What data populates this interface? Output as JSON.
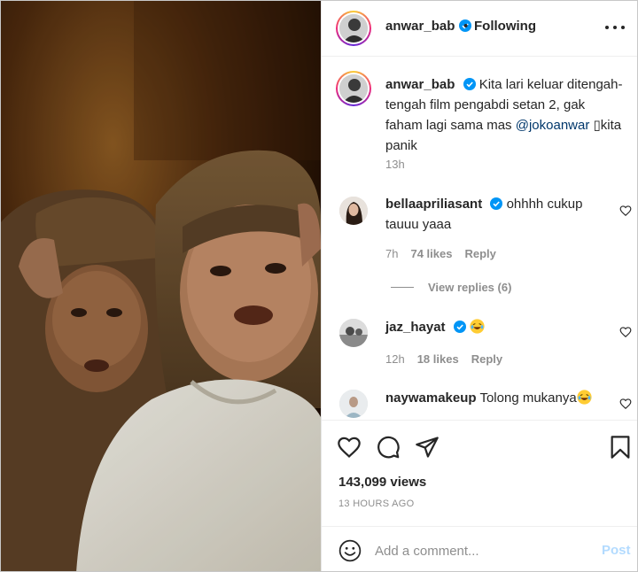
{
  "post": {
    "author": "anwar_bab",
    "follow_status": "Following",
    "dot": "•",
    "caption_prefix": "Kita lari keluar ditengah-tengah film pengabdi setan 2, gak faham lagi sama mas ",
    "caption_mention": "@jokoanwar",
    "caption_suffix": " ▯kita panik",
    "caption_time": "13h"
  },
  "comments": [
    {
      "user": "bellaapriliasant",
      "text": "ohhhh cukup tauuu yaaa",
      "time": "7h",
      "likes": "74 likes",
      "reply_label": "Reply",
      "view_replies": "View replies (6)"
    },
    {
      "user": "jaz_hayat",
      "time": "12h",
      "likes": "18 likes",
      "reply_label": "Reply"
    },
    {
      "user": "naywamakeup",
      "text": "Tolong mukanya"
    }
  ],
  "stats": {
    "views": "143,099 views",
    "posted_ago": "13 HOURS AGO"
  },
  "comment_box": {
    "placeholder": "Add a comment...",
    "post_label": "Post"
  },
  "colors": {
    "verified_blue": "#0095f6",
    "mention_blue": "#00376b",
    "post_disabled": "#b3dbff",
    "muted_gray": "#8e8e8e"
  },
  "icons": [
    "more-options-icon",
    "verified-badge-icon",
    "heart-icon",
    "comment-icon",
    "share-icon",
    "bookmark-icon",
    "emoji-smile-icon"
  ]
}
